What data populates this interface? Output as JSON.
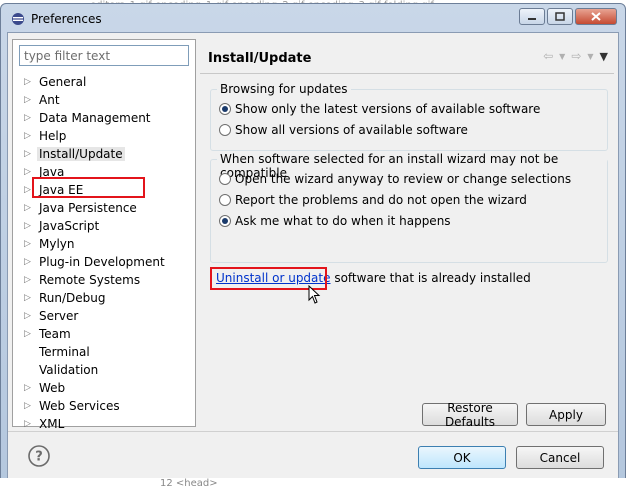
{
  "window": {
    "title": "Preferences",
    "background_tabs": "editors_1.gif        encoding_1.gif        encoding_2.gif        encoding_3.gif        folding.gif",
    "background_bottom": "12  <head>"
  },
  "filter": {
    "placeholder": "type filter text"
  },
  "tree": {
    "items": [
      {
        "label": "General",
        "expandable": true
      },
      {
        "label": "Ant",
        "expandable": true
      },
      {
        "label": "Data Management",
        "expandable": true
      },
      {
        "label": "Help",
        "expandable": true
      },
      {
        "label": "Install/Update",
        "expandable": true,
        "selected": true
      },
      {
        "label": "Java",
        "expandable": true
      },
      {
        "label": "Java EE",
        "expandable": true
      },
      {
        "label": "Java Persistence",
        "expandable": true
      },
      {
        "label": "JavaScript",
        "expandable": true
      },
      {
        "label": "Mylyn",
        "expandable": true
      },
      {
        "label": "Plug-in Development",
        "expandable": true
      },
      {
        "label": "Remote Systems",
        "expandable": true
      },
      {
        "label": "Run/Debug",
        "expandable": true
      },
      {
        "label": "Server",
        "expandable": true
      },
      {
        "label": "Team",
        "expandable": true
      },
      {
        "label": "Terminal",
        "expandable": false
      },
      {
        "label": "Validation",
        "expandable": false
      },
      {
        "label": "Web",
        "expandable": true
      },
      {
        "label": "Web Services",
        "expandable": true
      },
      {
        "label": "XML",
        "expandable": true
      }
    ]
  },
  "page": {
    "title": "Install/Update",
    "browsing": {
      "title": "Browsing for updates",
      "options": [
        {
          "label": "Show only the latest versions of available software",
          "selected": true
        },
        {
          "label": "Show all versions of available software",
          "selected": false
        }
      ]
    },
    "compat": {
      "title": "When software selected for an install wizard may not be compatible",
      "options": [
        {
          "label": "Open the wizard anyway to review or change selections",
          "selected": false
        },
        {
          "label": "Report the problems and do not open the wizard",
          "selected": false
        },
        {
          "label": "Ask me what to do when it happens",
          "selected": true
        }
      ]
    },
    "link_text": "Uninstall or update",
    "link_suffix": " software that is already installed"
  },
  "buttons": {
    "restore_defaults": "Restore Defaults",
    "apply": "Apply",
    "ok": "OK",
    "cancel": "Cancel"
  },
  "colors": {
    "highlight_box": "#e3141b",
    "link": "#0033cc"
  }
}
